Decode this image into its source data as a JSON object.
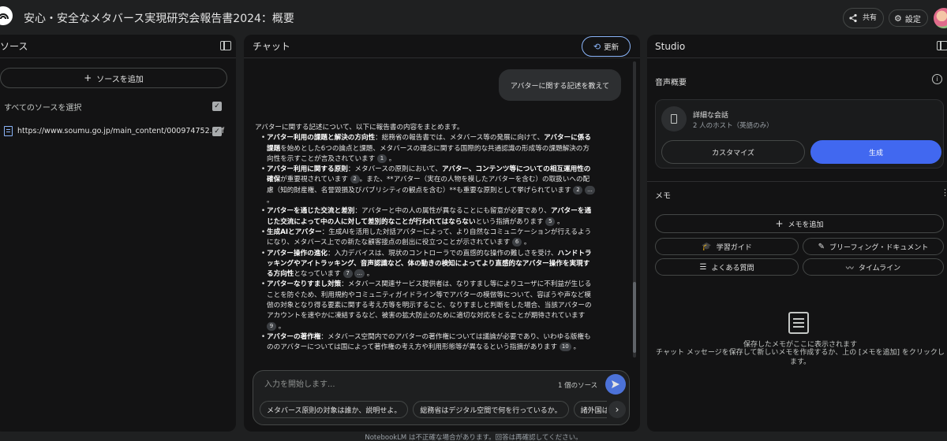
{
  "app": {
    "title": "安心・安全なメタバース実現研究会報告書2024：概要",
    "share_label": "共有",
    "settings_label": "設定"
  },
  "sources": {
    "header": "ソース",
    "add_label": "ソースを追加",
    "select_all_label": "すべてのソースを選択",
    "items": [
      {
        "title": "https://www.soumu.go.jp/main_content/000974752.pdf",
        "checked": true
      }
    ]
  },
  "chat": {
    "header": "チャット",
    "update_label": "更新",
    "user_message": "アバターに関する記述を教えて",
    "answer": {
      "intro": "アバターに関する記述について、以下に報告書の内容をまとめます。",
      "items": [
        {
          "bold": "アバター利用の課題と解決の方向性",
          "t1": "：総務省の報告書では、メタバース等の発展に向けて、",
          "bold2": "アバターに係る課題",
          "t2": "を始めとした6つの論点と課題、メタバースの理念に関する国際的な共通認識の形成等の課題解決の方向性を示すことが言及されています",
          "cites": [
            "1"
          ]
        },
        {
          "bold": "アバター利用に関する原則",
          "t1": "：メタバースの原則において、",
          "bold2": "アバター、コンテンツ等についての相互運用性の確保",
          "t2": "が重要視されています",
          "cites": [
            "2"
          ],
          "t3": "。また、**アバター（実在の人物を模したアバターを含む）の取扱いへの配慮（知的財産権、名誉毀損及びパブリシティの観点を含む）**も重要な原則として挙げられています",
          "cites2": [
            "2",
            "..."
          ]
        },
        {
          "bold": "アバターを通じた交流と差別",
          "t1": "：アバターと中の人の属性が異なることにも留意が必要であり、",
          "bold2": "アバターを通じた交流によって中の人に対して差別的なことが行われてはならない",
          "t2": "という指摘があります",
          "cites": [
            "5"
          ]
        },
        {
          "bold": "生成AIとアバター",
          "t1": "：生成AIを活用した対話アバターによって、より自然なコミュニケーションが行えるようになり、メタバース上での新たな顧客接点の創出に役立つことが示されています",
          "bold2": "",
          "t2": "",
          "cites": [
            "6"
          ]
        },
        {
          "bold": "アバター操作の進化",
          "t1": "：入力デバイスは、現状のコントローラでの直感的な操作の難しさを受け、",
          "bold2": "ハンドトラッキングやアイトラッキング、音声認識など、体の動きの検知によってより直感的なアバター操作を実現する方向性",
          "t2": "となっています",
          "cites": [
            "7",
            "..."
          ]
        },
        {
          "bold": "アバターなりすまし対策",
          "t1": "：メタバース関連サービス提供者は、なりすまし等によりユーザに不利益が生じることを防ぐため、利用規約やコミュニティガイドライン等でアバターの模倣等について、容ぼうや声など模倣の対象となり得る要素に関する考え方等を明示すること、なりすましと判断をした場合、当該アバターのアカウントを速やかに凍結するなど、被害の拡大防止のために適切な対応をとることが期待されています",
          "bold2": "",
          "t2": "",
          "cites": [
            "9"
          ]
        },
        {
          "bold": "アバターの著作権",
          "t1": "：メタバース空間内でのアバターの著作権については議論が必要であり、いわゆる版権もののアバターについては国によって著作権の考え方や利用形態等が異なるという指摘があります",
          "bold2": "",
          "t2": "",
          "cites": [
            "10"
          ]
        }
      ]
    },
    "input_placeholder": "入力を開始します...",
    "source_count": "1 個のソース",
    "suggestions": [
      "メタバース原則の対象は誰か、説明せよ。",
      "総務省はデジタル空間で何を行っているか。",
      "諸外国は万"
    ]
  },
  "studio": {
    "header": "Studio",
    "audio_title": "音声概要",
    "audio_card": {
      "name": "詳細な会話",
      "sub": "2 人のホスト（英語のみ）",
      "customize_label": "カスタマイズ",
      "generate_label": "生成"
    },
    "memo_title": "メモ",
    "add_memo_label": "メモを追加",
    "tools": [
      {
        "label": "学習ガイド",
        "icon": "graduation-cap-icon"
      },
      {
        "label": "ブリーフィング・ドキュメント",
        "icon": "document-edit-icon"
      },
      {
        "label": "よくある質問",
        "icon": "faq-icon"
      },
      {
        "label": "タイムライン",
        "icon": "timeline-icon"
      }
    ],
    "empty_title": "保存したメモがここに表示されます",
    "empty_desc": "チャット メッセージを保存して新しいメモを作成するか、上の [メモを追加] をクリックします。"
  },
  "footer": "NotebookLM は不正確な場合があります。回答は再確認してください。",
  "colors": {
    "accent": "#4168f0",
    "link": "#8ab4f8",
    "panel": "#131314",
    "background": "#1f2021"
  }
}
